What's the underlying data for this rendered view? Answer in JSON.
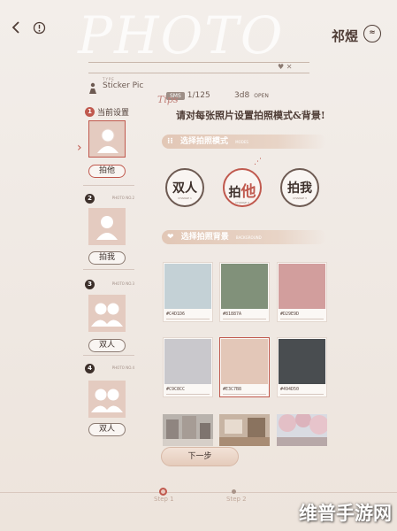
{
  "header": {
    "bg_title": "PHOTO",
    "back_icon": "chevron-left-icon",
    "alert_icon": "alert-circle-icon",
    "user_name": "祁煜",
    "user_badge": "≈"
  },
  "info": {
    "type_caption": "TYPE",
    "type_value": "Sticker Pic",
    "count_pill": "SMS",
    "count_value": "1/125",
    "open_value": "3d8",
    "open_label": "OPEN"
  },
  "tips": {
    "label": "Tips",
    "text": "请对每张照片设置拍照模式&背景!"
  },
  "left_list": {
    "current_label": "当前设置",
    "slots": [
      {
        "num": "1",
        "caption": "",
        "button": "拍他",
        "active": true
      },
      {
        "num": "2",
        "caption": "PHOTO NO.2",
        "button": "拍我",
        "active": false
      },
      {
        "num": "3",
        "caption": "PHOTO NO.3",
        "button": "双人",
        "active": false
      },
      {
        "num": "4",
        "caption": "PHOTO NO.4",
        "button": "双人",
        "active": false
      }
    ]
  },
  "mode_section": {
    "title": "选择拍照模式",
    "subtitle": "MODES",
    "modes": [
      {
        "label": "双人",
        "caption": "CHANGE 1"
      },
      {
        "label": "拍他",
        "caption": "CHANGE 2"
      },
      {
        "label": "拍我",
        "caption": "CHANGE 3"
      }
    ]
  },
  "bg_section": {
    "title": "选择拍照背景",
    "subtitle": "BACKGROUND",
    "swatches": [
      {
        "hex": "#C4D1D6",
        "color": "#c4d1d6"
      },
      {
        "hex": "#81887A",
        "color": "#81917a"
      },
      {
        "hex": "#D29E9D",
        "color": "#d29e9d"
      },
      {
        "hex": "#C9C8CC",
        "color": "#c9c8cc"
      },
      {
        "hex": "#E3C7B8",
        "color": "#e3c7b8"
      },
      {
        "hex": "#494D50",
        "color": "#494d50"
      }
    ]
  },
  "next_button": "下一步",
  "steps": {
    "step1": "Step 1",
    "step2": "Step 2"
  },
  "watermark": "维普手游网",
  "colors": {
    "accent": "#c0594e",
    "background": "#f1ebe6",
    "text": "#4f3d36"
  }
}
